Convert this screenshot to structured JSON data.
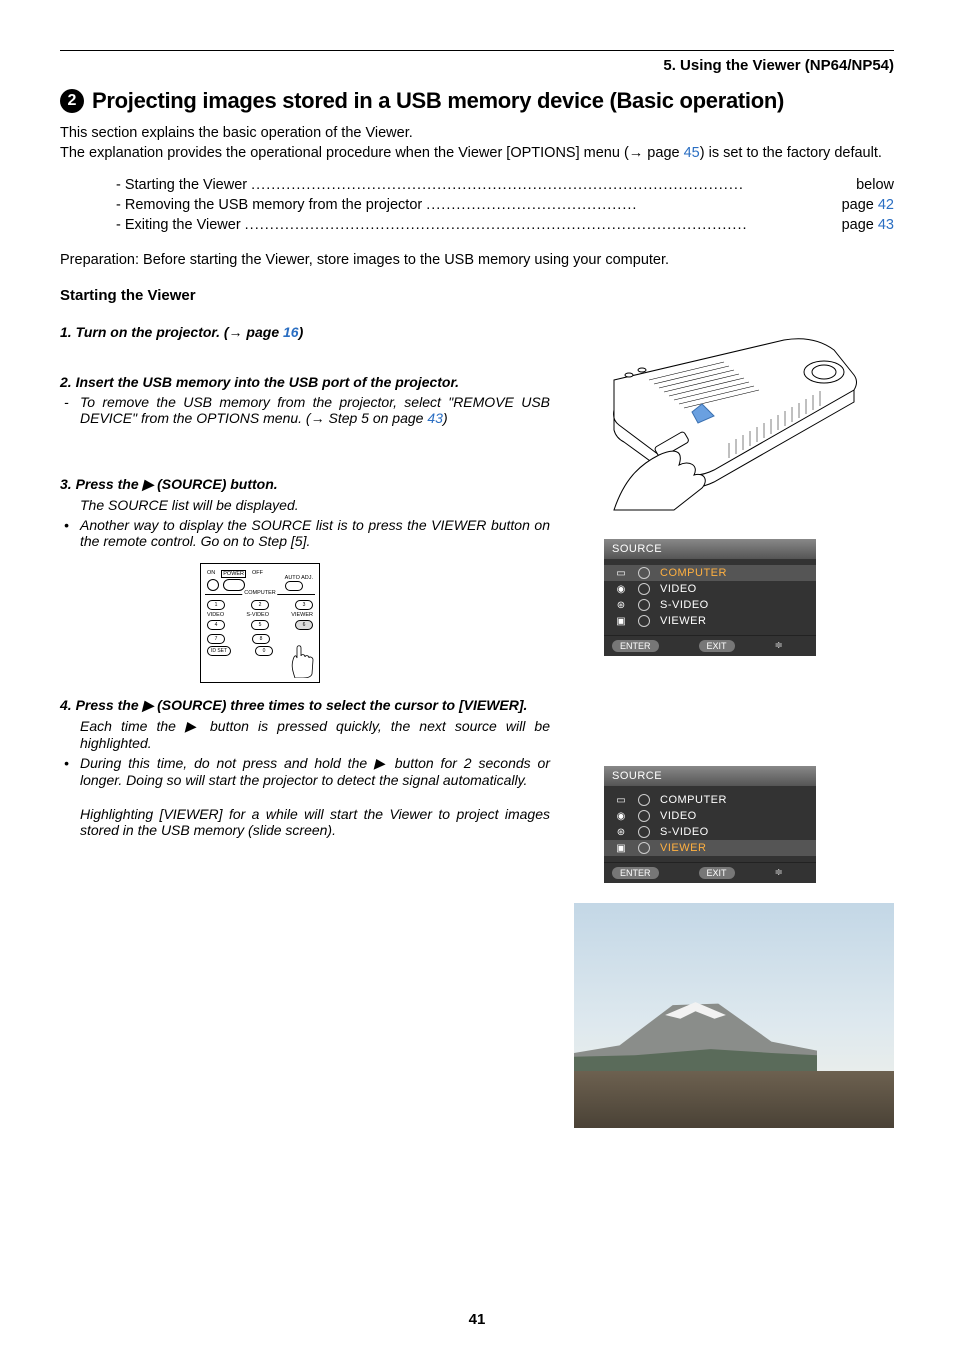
{
  "chapter_header": "5. Using the Viewer (NP64/NP54)",
  "title_number": "2",
  "title_text": "Projecting images stored in a USB memory device (Basic operation)",
  "intro_line1": "This section explains the basic operation of the Viewer.",
  "intro_line2_a": "The explanation provides the operational procedure when the Viewer [OPTIONS] menu (",
  "intro_arrow": "→",
  "intro_line2_b": " page ",
  "intro_page_link": "45",
  "intro_line2_c": ") is set to the factory default.",
  "toc": [
    {
      "label": "- Starting the Viewer",
      "page_prefix": "",
      "page": "below",
      "is_link": false
    },
    {
      "label": "- Removing the USB memory from the projector",
      "page_prefix": "page ",
      "page": "42",
      "is_link": true
    },
    {
      "label": "- Exiting the Viewer",
      "page_prefix": "page ",
      "page": "43",
      "is_link": true
    }
  ],
  "prep_text": "Preparation: Before starting the Viewer, store images to the USB memory using your computer.",
  "starting_heading": "Starting the Viewer",
  "step1_a": "1.  Turn on the projector. (",
  "step1_arrow": "→",
  "step1_b": " page ",
  "step1_link": "16",
  "step1_c": ")",
  "step2": "2.  Insert the USB memory into the USB port of the projector.",
  "step2_note_a": "To remove the USB memory from the projector, select \"REMOVE USB DEVICE\" from the OPTIONS menu. (",
  "step2_note_arrow": "→",
  "step2_note_b": " Step 5 on page ",
  "step2_note_link": "43",
  "step2_note_c": ")",
  "step3": "3.  Press the ▶ (SOURCE) button.",
  "step3_note": "The SOURCE list will be displayed.",
  "step3_bullet": "Another way to display the SOURCE list is to press the VIEWER button on the remote control. Go on to Step [5].",
  "step4": "4.  Press the ▶ (SOURCE) three times to select the cursor to [VIEWER].",
  "step4_note1": "Each time the ▶ button is pressed quickly, the next source will be highlighted.",
  "step4_bullet": "During this time, do not press and hold the ▶ button for 2 seconds or longer. Doing so will start the projector to detect the signal automatically.",
  "step4_note2": "Highlighting [VIEWER] for a while will start the Viewer to project images stored in the USB memory (slide screen).",
  "remote": {
    "power_on": "ON",
    "power": "POWER",
    "power_off": "OFF",
    "auto": "AUTO ADJ.",
    "computer": "COMPUTER",
    "video": "VIDEO",
    "svideo": "S-VIDEO",
    "viewer": "VIEWER",
    "n1": "1",
    "n2": "2",
    "n3": "3",
    "n4": "4",
    "n5": "5",
    "n6": "6",
    "n7": "7",
    "n8": "8",
    "n0": "0",
    "idset": "ID SET"
  },
  "source_menu": {
    "title": "SOURCE",
    "items": [
      "COMPUTER",
      "VIDEO",
      "S-VIDEO",
      "VIEWER"
    ],
    "enter": "ENTER",
    "exit": "EXIT"
  },
  "menu1_selected_index": 0,
  "menu2_selected_index": 3,
  "page_number": "41"
}
